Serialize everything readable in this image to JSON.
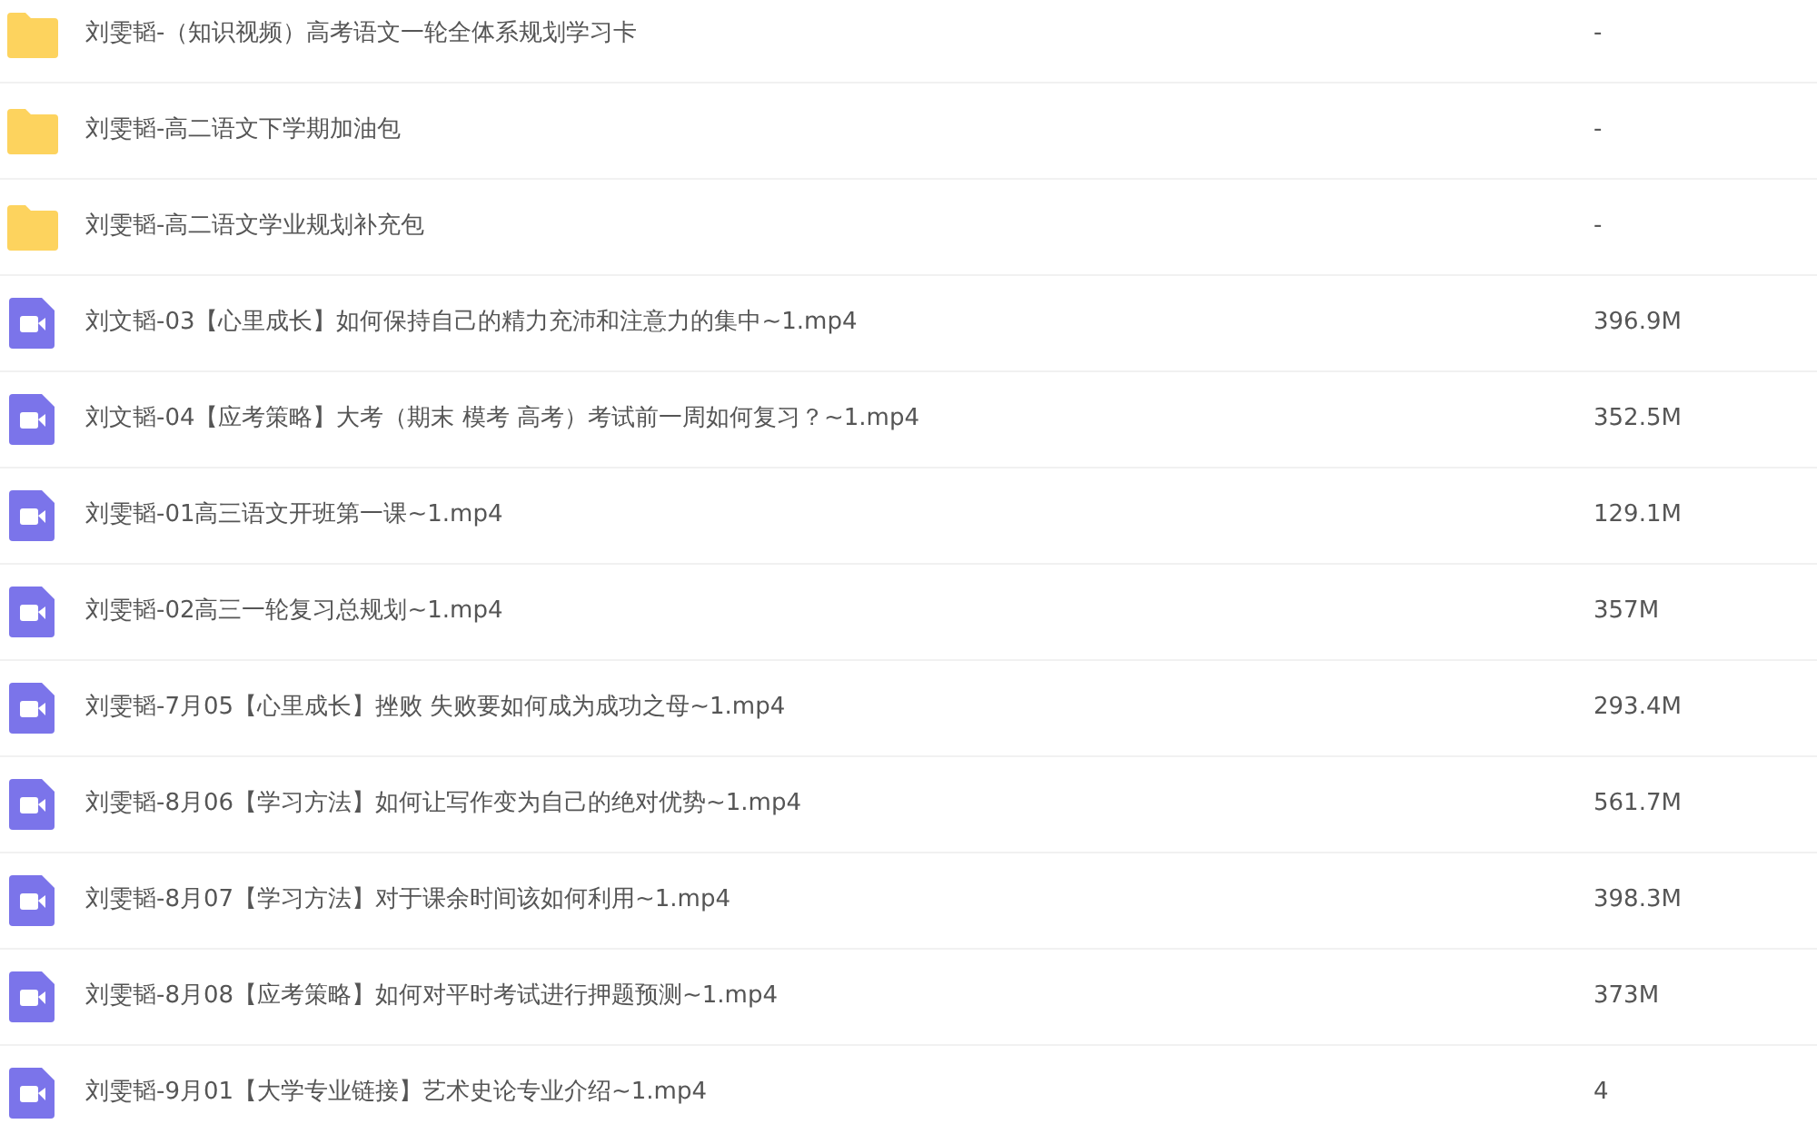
{
  "files": [
    {
      "kind": "folder",
      "name": "刘雯韬-（知识视频）高考语文一轮全体系规划学习卡",
      "size": "-"
    },
    {
      "kind": "folder",
      "name": "刘雯韬-高二语文下学期加油包",
      "size": "-"
    },
    {
      "kind": "folder",
      "name": "刘雯韬-高二语文学业规划补充包",
      "size": "-"
    },
    {
      "kind": "video",
      "name": "刘文韬-03【心里成长】如何保持自己的精力充沛和注意力的集中~1.mp4",
      "size": "396.9M"
    },
    {
      "kind": "video",
      "name": "刘文韬-04【应考策略】大考（期末 模考 高考）考试前一周如何复习？~1.mp4",
      "size": "352.5M"
    },
    {
      "kind": "video",
      "name": "刘雯韬-01高三语文开班第一课~1.mp4",
      "size": "129.1M"
    },
    {
      "kind": "video",
      "name": "刘雯韬-02高三一轮复习总规划~1.mp4",
      "size": "357M"
    },
    {
      "kind": "video",
      "name": "刘雯韬-7月05【心里成长】挫败 失败要如何成为成功之母~1.mp4",
      "size": "293.4M"
    },
    {
      "kind": "video",
      "name": "刘雯韬-8月06【学习方法】如何让写作变为自己的绝对优势~1.mp4",
      "size": "561.7M"
    },
    {
      "kind": "video",
      "name": "刘雯韬-8月07【学习方法】对于课余时间该如何利用~1.mp4",
      "size": "398.3M"
    },
    {
      "kind": "video",
      "name": "刘雯韬-8月08【应考策略】如何对平时考试进行押题预测~1.mp4",
      "size": "373M"
    },
    {
      "kind": "video",
      "name": "刘雯韬-9月01【大学专业链接】艺术史论专业介绍~1.mp4",
      "size": "4"
    }
  ]
}
